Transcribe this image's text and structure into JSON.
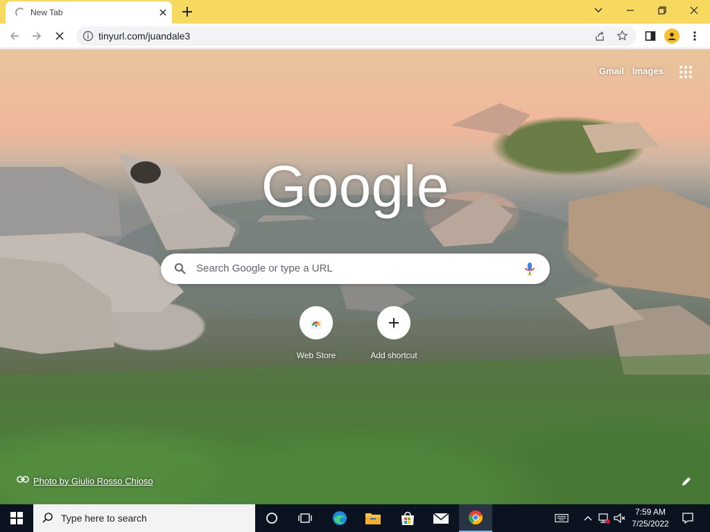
{
  "browser": {
    "tab": {
      "title": "New Tab"
    },
    "omnibox": {
      "url": "tinyurl.com/juandale3"
    }
  },
  "ntp": {
    "links": {
      "gmail": "Gmail",
      "images": "Images"
    },
    "logo": "Google",
    "search": {
      "placeholder": "Search Google or type a URL"
    },
    "shortcuts": [
      {
        "label": "Web Store",
        "icon": "webstore-icon"
      },
      {
        "label": "Add shortcut",
        "icon": "plus-icon"
      }
    ],
    "photo_credit": "Photo by Giulio Rosso Chioso"
  },
  "taskbar": {
    "search_placeholder": "Type here to search",
    "time": "7:59 AM",
    "date": "7/25/2022"
  },
  "colors": {
    "tabstrip": "#f8d960",
    "taskbar": "#0c1320",
    "omnibox": "#f1f3f4",
    "avatar": "#f5c12e"
  }
}
